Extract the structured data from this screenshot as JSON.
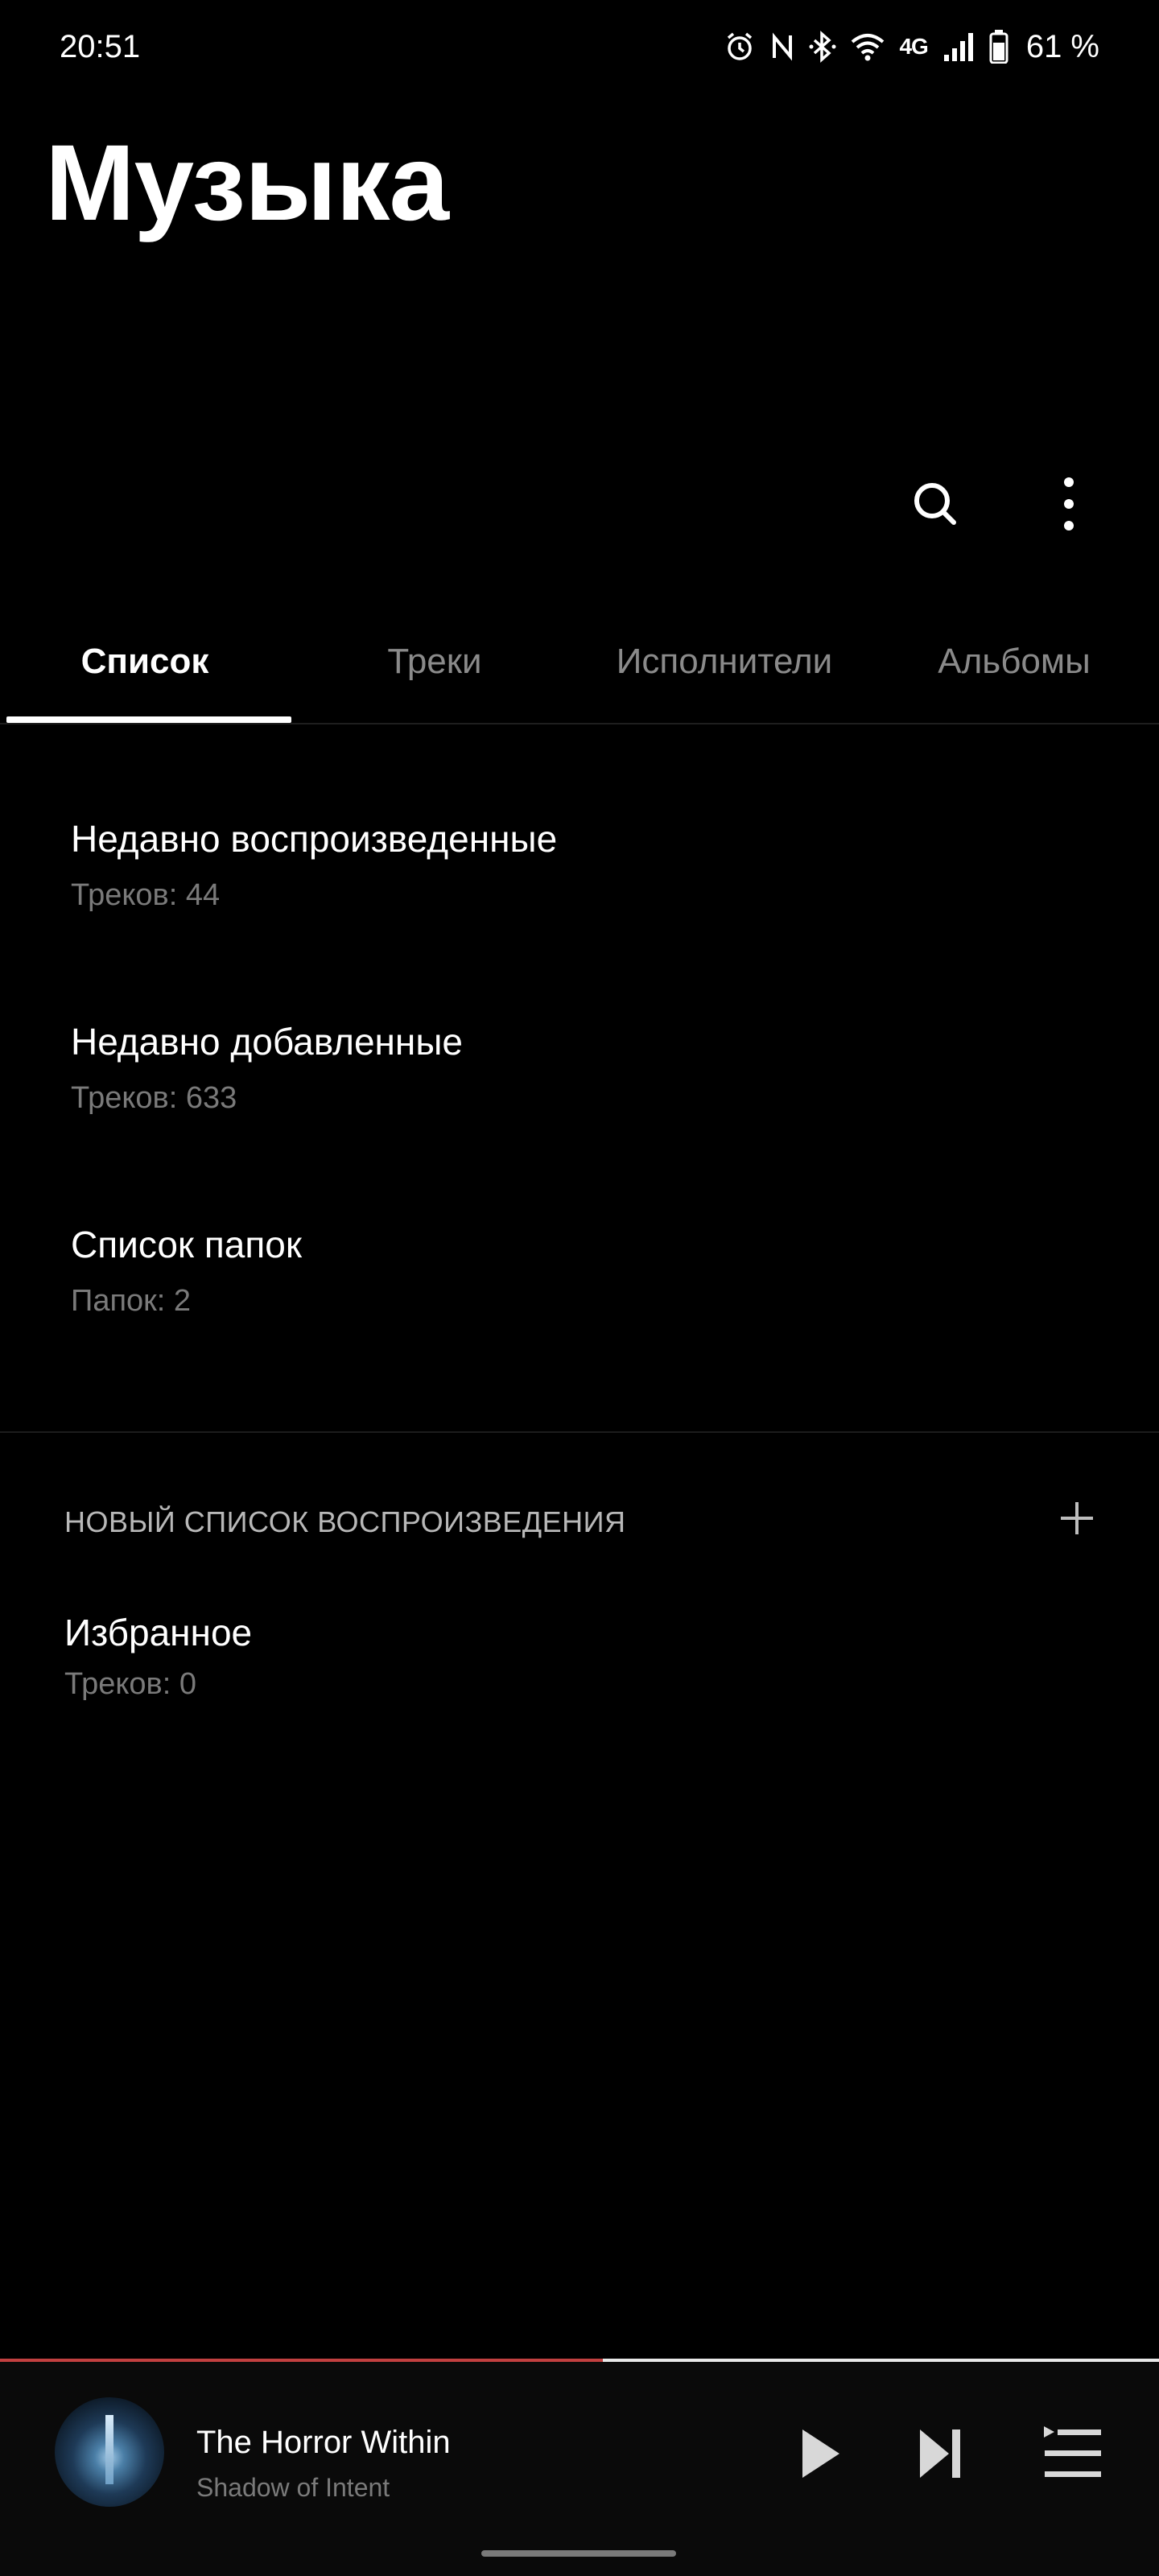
{
  "status_bar": {
    "time": "20:51",
    "network": "4G",
    "battery": "61 %",
    "icons": [
      "alarm-icon",
      "nfc-icon",
      "bluetooth-icon",
      "wifi-icon",
      "signal-icon",
      "battery-icon"
    ]
  },
  "header": {
    "title": "Музыка"
  },
  "toolbar": {
    "search_icon": "search-icon",
    "more_icon": "more-vert-icon"
  },
  "tabs": [
    {
      "label": "Список",
      "active": true
    },
    {
      "label": "Треки",
      "active": false
    },
    {
      "label": "Исполнители",
      "active": false
    },
    {
      "label": "Альбомы",
      "active": false
    }
  ],
  "lists": [
    {
      "title": "Недавно воспроизведенные",
      "subtitle": "Треков: 44"
    },
    {
      "title": "Недавно добавленные",
      "subtitle": "Треков: 633"
    },
    {
      "title": "Список папок",
      "subtitle": "Папок: 2"
    }
  ],
  "playlists_section": {
    "header": "НОВЫЙ СПИСОК ВОСПРОИЗВЕДЕНИЯ",
    "add_icon": "plus-icon",
    "items": [
      {
        "title": "Избранное",
        "subtitle": "Треков: 0"
      }
    ]
  },
  "player": {
    "title": "The Horror Within",
    "artist": "Shadow of Intent",
    "progress": 0.52,
    "controls": [
      "play-icon",
      "skip-next-icon",
      "queue-icon"
    ]
  },
  "colors": {
    "background": "#000000",
    "accent": "#c24040",
    "secondary_text": "#7a7a7a"
  }
}
